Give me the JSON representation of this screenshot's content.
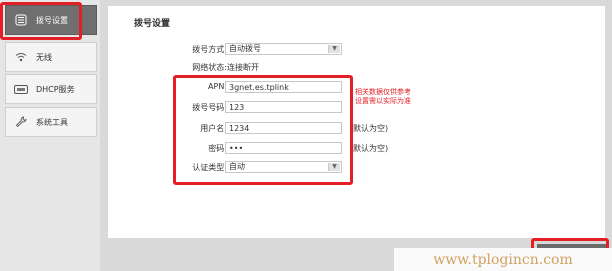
{
  "sidebar": {
    "items": [
      {
        "label": "拨号设置",
        "icon": "dialup-icon",
        "active": true
      },
      {
        "label": "无线",
        "icon": "wifi-icon",
        "active": false
      },
      {
        "label": "DHCP服务",
        "icon": "dhcp-icon",
        "active": false
      },
      {
        "label": "系统工具",
        "icon": "wrench-icon",
        "active": false
      }
    ]
  },
  "main": {
    "title": "拨号设置",
    "dial_mode": {
      "label": "拨号方式:",
      "value": "自动拨号"
    },
    "net_status": {
      "label": "网络状态:",
      "value": "连接断开"
    },
    "apn": {
      "label": "APN:",
      "value": "3gnet.es.tplink"
    },
    "dial_number": {
      "label": "拨号号码:",
      "value": "123"
    },
    "username": {
      "label": "用户名:",
      "value": "1234",
      "note": "默认为空)"
    },
    "password": {
      "label": "密码:",
      "value": "•••",
      "note": "默认为空)"
    },
    "auth_type": {
      "label": "认证类型:",
      "value": "自动"
    },
    "hint": {
      "line1": "相关数据仅供参考",
      "line2": "设置需以实际为准"
    }
  },
  "watermark": "www.tplogincn.com",
  "colors": {
    "highlight": "#e31e24",
    "active_nav": "#6f6f6f"
  }
}
